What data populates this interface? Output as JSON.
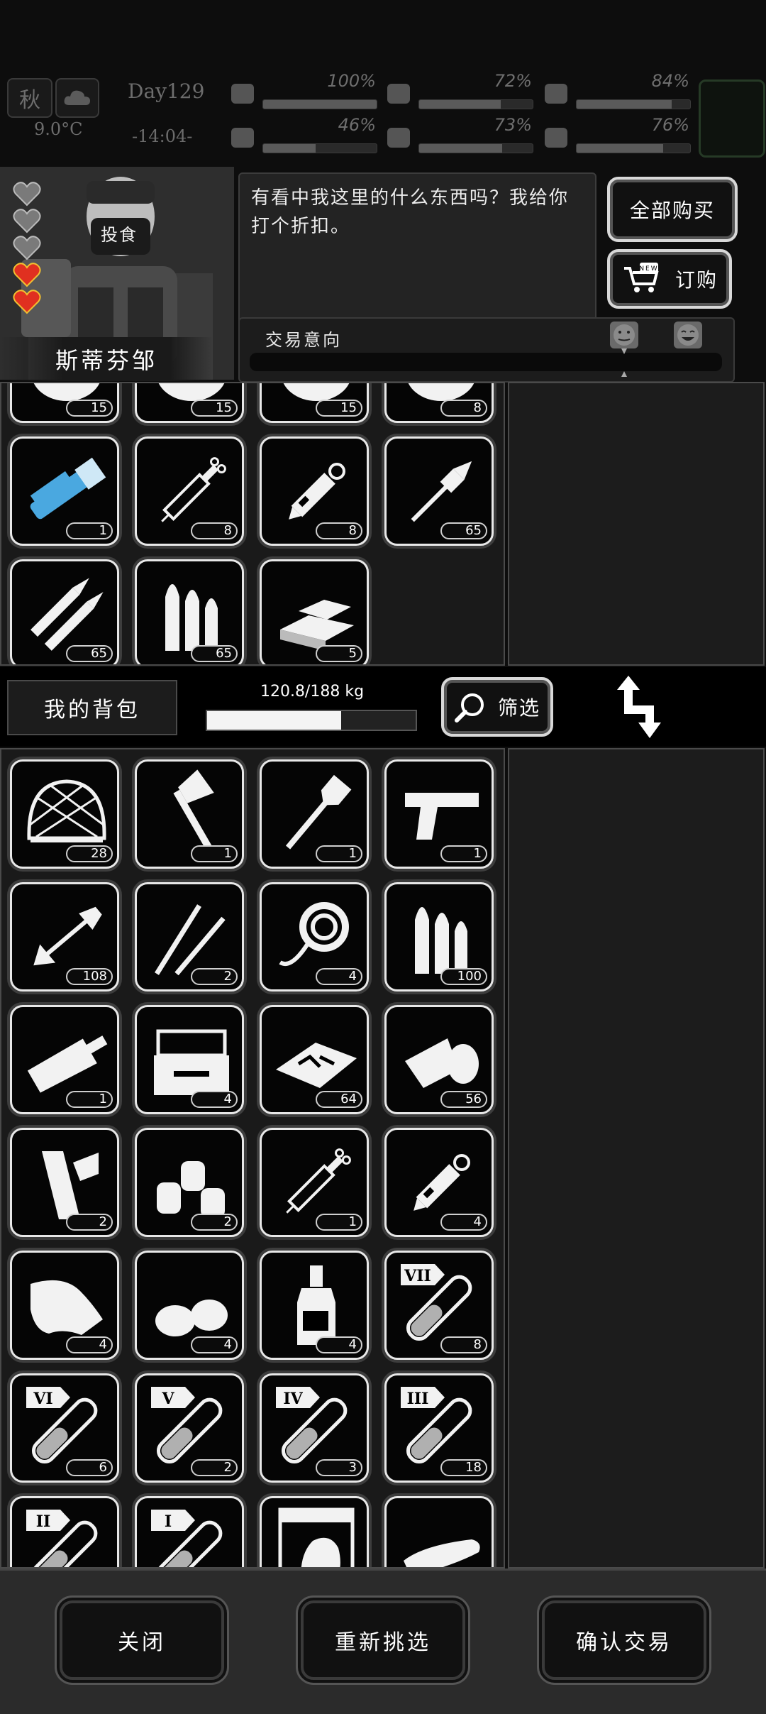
{
  "status": {
    "season": "秋",
    "day": "Day129",
    "temperature": "9.0°C",
    "time": "-14:04-",
    "bars": [
      {
        "icon": "medkit-icon",
        "percent": "100%",
        "value": 1.0
      },
      {
        "icon": "stomach-icon",
        "percent": "72%",
        "value": 0.72
      },
      {
        "icon": "lungs-icon",
        "percent": "84%",
        "value": 0.84
      },
      {
        "icon": "boot-icon",
        "percent": "46%",
        "value": 0.46
      },
      {
        "icon": "water-drop-icon",
        "percent": "73%",
        "value": 0.73
      },
      {
        "icon": "heart-icon",
        "percent": "76%",
        "value": 0.76
      }
    ]
  },
  "trader": {
    "name": "斯蒂芬邹",
    "mask_text": "投食",
    "dialog": "有看中我这里的什么东西吗？我给你打个折扣。",
    "buy_all_label": "全部购买",
    "order_label": "订购",
    "order_badge": "NEW",
    "intent_label": "交易意向",
    "trust_hearts": {
      "empty": 3,
      "filled": 2
    },
    "heart_color": "#e03020"
  },
  "trader_items": [
    {
      "icon": "cheese-icon",
      "count": "15"
    },
    {
      "icon": "food-icon",
      "count": "15"
    },
    {
      "icon": "food-icon",
      "count": "15"
    },
    {
      "icon": "plate-icon",
      "count": "8"
    },
    {
      "icon": "minigun-icon",
      "count": "1"
    },
    {
      "icon": "syringe-icon",
      "count": "8"
    },
    {
      "icon": "adrenaline-syringe-icon",
      "count": "8"
    },
    {
      "icon": "rocket-icon",
      "count": "65"
    },
    {
      "icon": "rifle-bullets-icon",
      "count": "65"
    },
    {
      "icon": "bullets-icon",
      "count": "65"
    },
    {
      "icon": "gold-bars-icon",
      "count": "5"
    }
  ],
  "bag": {
    "title": "我的背包",
    "weight": "120.8/188 kg",
    "weight_fraction": 0.643,
    "filter_label": "筛选"
  },
  "bag_items": [
    {
      "icon": "net-icon",
      "count": "28"
    },
    {
      "icon": "axe-icon",
      "count": "1"
    },
    {
      "icon": "shovel-icon",
      "count": "1"
    },
    {
      "icon": "pistol-icon",
      "count": "1"
    },
    {
      "icon": "arrow-icon",
      "count": "108"
    },
    {
      "icon": "lockpick-icon",
      "count": "2"
    },
    {
      "icon": "rope-icon",
      "count": "4"
    },
    {
      "icon": "bullets-icon",
      "count": "100"
    },
    {
      "icon": "cleaver-icon",
      "count": "1"
    },
    {
      "icon": "toolbox-icon",
      "count": "4"
    },
    {
      "icon": "scrap-icon",
      "count": "64"
    },
    {
      "icon": "bandage-icon",
      "count": "56"
    },
    {
      "icon": "splint-icon",
      "count": "2"
    },
    {
      "icon": "jars-icon",
      "count": "2"
    },
    {
      "icon": "syringe-icon",
      "count": "1"
    },
    {
      "icon": "adrenaline-syringe-icon",
      "count": "4"
    },
    {
      "icon": "cloth-icon",
      "count": "4"
    },
    {
      "icon": "potatoes-icon",
      "count": "4"
    },
    {
      "icon": "bottle-icon",
      "count": "4"
    },
    {
      "icon": "test-tube-icon",
      "tier": "VII",
      "count": "8"
    },
    {
      "icon": "test-tube-icon",
      "tier": "VI",
      "count": "6"
    },
    {
      "icon": "test-tube-icon",
      "tier": "V",
      "count": "2"
    },
    {
      "icon": "test-tube-icon",
      "tier": "IV",
      "count": "3"
    },
    {
      "icon": "test-tube-icon",
      "tier": "III",
      "count": "18"
    },
    {
      "icon": "test-tube-icon",
      "tier": "II",
      "count": ""
    },
    {
      "icon": "test-tube-icon",
      "tier": "I",
      "count": ""
    },
    {
      "icon": "zombie-card-icon",
      "count": ""
    },
    {
      "icon": "case-icon",
      "count": ""
    }
  ],
  "footer": {
    "close_label": "关闭",
    "reselect_label": "重新挑选",
    "confirm_label": "确认交易"
  }
}
